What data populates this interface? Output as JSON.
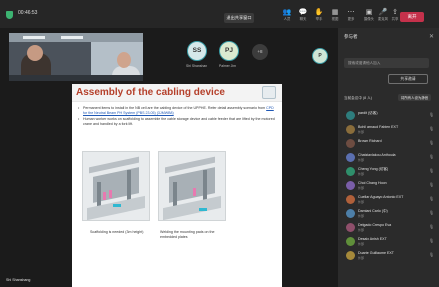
{
  "topbar": {
    "timer": "00:46:53",
    "action_label": "退出共享窗口",
    "icons": [
      {
        "icon": "people-icon",
        "label": "人员"
      },
      {
        "icon": "chat-icon",
        "label": "聊天"
      },
      {
        "icon": "hand-icon",
        "label": "举手"
      },
      {
        "icon": "view-icon",
        "label": "视图"
      },
      {
        "icon": "more-icon",
        "label": "更多"
      },
      {
        "icon": "camera-icon",
        "label": "摄像头"
      },
      {
        "icon": "mic-icon",
        "label": "麦克风"
      },
      {
        "icon": "share-icon",
        "label": "共享"
      }
    ],
    "leave_label": "离开"
  },
  "tiles": [
    {
      "initials": "SS",
      "name": "Shi Shanshan",
      "color": "#d5e8ea"
    },
    {
      "initials": "PJ",
      "name": "Palmer Jim",
      "color": "#dbead0"
    }
  ],
  "more_tile": "+8",
  "floating_avatar": "P",
  "slide": {
    "title": "Assembly of the cabling device",
    "bullets": [
      {
        "text": "Permanent items to install in the NB cell are the cabling device of the UPPHE. Refer detail assembly scenario from ",
        "link": "CPD for the Neutral Beam PH System (PBS 23.05) (3JMWB8)"
      },
      {
        "text": "Human worker works on scaffolding to assemble the cable storage device and cable feeder that are lifted by the motored crane and handled by a fork lift.",
        "link": ""
      }
    ],
    "caption_left": "Scaffolding is needed (3m height)",
    "caption_right": "Welding the mounting pads on the embedded plates"
  },
  "bottom": {
    "presenter_name": "Shi Shanshang"
  },
  "panel": {
    "title": "参与者",
    "search_placeholder": "搜索或邀请他人加入",
    "share_label": "共享邀请",
    "section": "当前会议中 (8 人)",
    "section_action": "将所有人设为静音",
    "participants": [
      {
        "name": "pardit (访客)",
        "sub": "",
        "color": "#2e7d7d"
      },
      {
        "name": "Bohil arnaud Fabien EXT",
        "sub": "外部",
        "color": "#8a6d3b"
      },
      {
        "name": "Brown Richard",
        "sub": "",
        "color": "#6d4c41"
      },
      {
        "name": "Chatziavlakou Anthoula",
        "sub": "外部",
        "color": "#5b6fb0"
      },
      {
        "name": "Cheng Yong (访客)",
        "sub": "外部",
        "color": "#2f8f6b"
      },
      {
        "name": "Choi Chang Hoon",
        "sub": "外部",
        "color": "#7a5ea8"
      },
      {
        "name": "Cuellar Aguayo Antonio EXT",
        "sub": "外部",
        "color": "#b0603a"
      },
      {
        "name": "Damiani Carlo (中)",
        "sub": "外部",
        "color": "#4d7fa8"
      },
      {
        "name": "Delgado Crespo Eva",
        "sub": "外部",
        "color": "#8f4f6b"
      },
      {
        "name": "Desaix Anish EXT",
        "sub": "外部",
        "color": "#5f8f3a"
      },
      {
        "name": "Duarte Guillaume EXT",
        "sub": "外部",
        "color": "#a5893a"
      }
    ]
  }
}
